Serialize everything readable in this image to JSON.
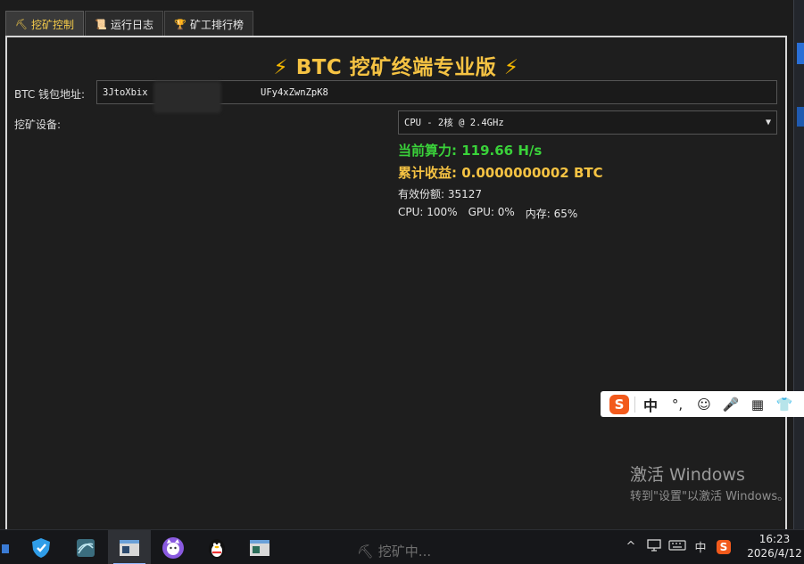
{
  "tabs": [
    {
      "icon": "pickaxe-icon",
      "glyph": "⛏",
      "label": "挖矿控制",
      "active": true
    },
    {
      "icon": "scroll-icon",
      "glyph": "📜",
      "label": "运行日志",
      "active": false
    },
    {
      "icon": "trophy-icon",
      "glyph": "🏆",
      "label": "矿工排行榜",
      "active": false
    }
  ],
  "title": {
    "bolt": "⚡",
    "text": "BTC 挖矿终端专业版"
  },
  "wallet": {
    "label": "BTC 钱包地址:",
    "value": "3JtoXbix                    UFy4xZwnZpK8"
  },
  "device": {
    "label": "挖矿设备:",
    "selected": "CPU - 2核 @ 2.4GHz"
  },
  "stats": {
    "hashrate": "当前算力: 119.66 H/s",
    "earnings": "累计收益: 0.0000000002 BTC",
    "shares": "有效份额: 35127",
    "cpu": "CPU: 100%",
    "gpu": "GPU: 0%",
    "mem": "内存: 65%"
  },
  "ime": {
    "mode": "中",
    "items": [
      "°,",
      "☺",
      "🎤",
      "▦",
      "👕"
    ]
  },
  "watermark": {
    "line1": "激活 Windows",
    "line2": "转到\"设置\"以激活 Windows。"
  },
  "taskbar": {
    "mining_label": "⛏ 挖矿中...",
    "tray_ime": "中",
    "time": "16:23",
    "date": "2026/4/12"
  },
  "colors": {
    "accent": "#f6c343",
    "hashrate": "#3ad23a",
    "ime_logo": "#f25a1c"
  }
}
